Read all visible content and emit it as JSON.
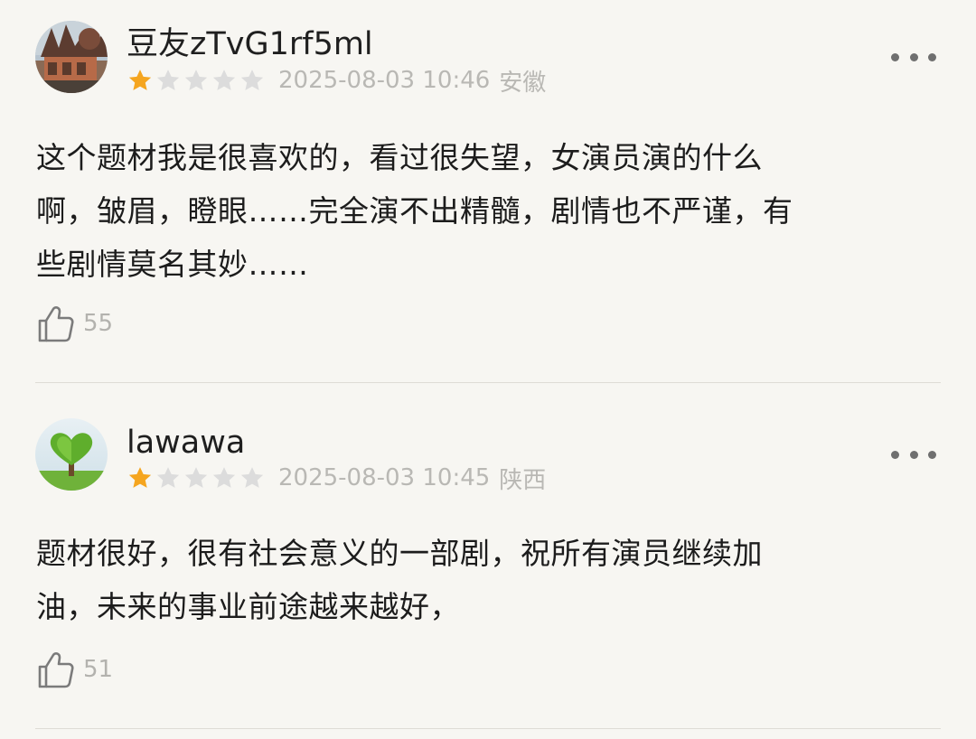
{
  "reviews": [
    {
      "username": "豆友zTvG1rf5ml",
      "rating": 1,
      "max_rating": 5,
      "time": "2025-08-03 10:46",
      "region": "安徽",
      "lines": [
        "这个题材我是很喜欢的，看过很失望，女演员演的什么",
        "啊，皱眉，瞪眼……完全演不出精髓，剧情也不严谨，有",
        "些剧情莫名其妙……"
      ],
      "likes": "55"
    },
    {
      "username": "lawawa",
      "rating": 1,
      "max_rating": 5,
      "time": "2025-08-03 10:45",
      "region": "陕西",
      "lines": [
        "题材很好，很有社会意义的一部剧，祝所有演员继续加",
        "油，未来的事业前途越来越好，"
      ],
      "likes": "51"
    }
  ],
  "colors": {
    "background": "#f7f6f2",
    "star_filled": "#f5a51f",
    "star_empty": "#dcdcdc",
    "meta_text": "#b9b8b4"
  },
  "icons": {
    "more": "more-dots-icon",
    "like": "thumbs-up-icon",
    "star": "star-icon"
  }
}
